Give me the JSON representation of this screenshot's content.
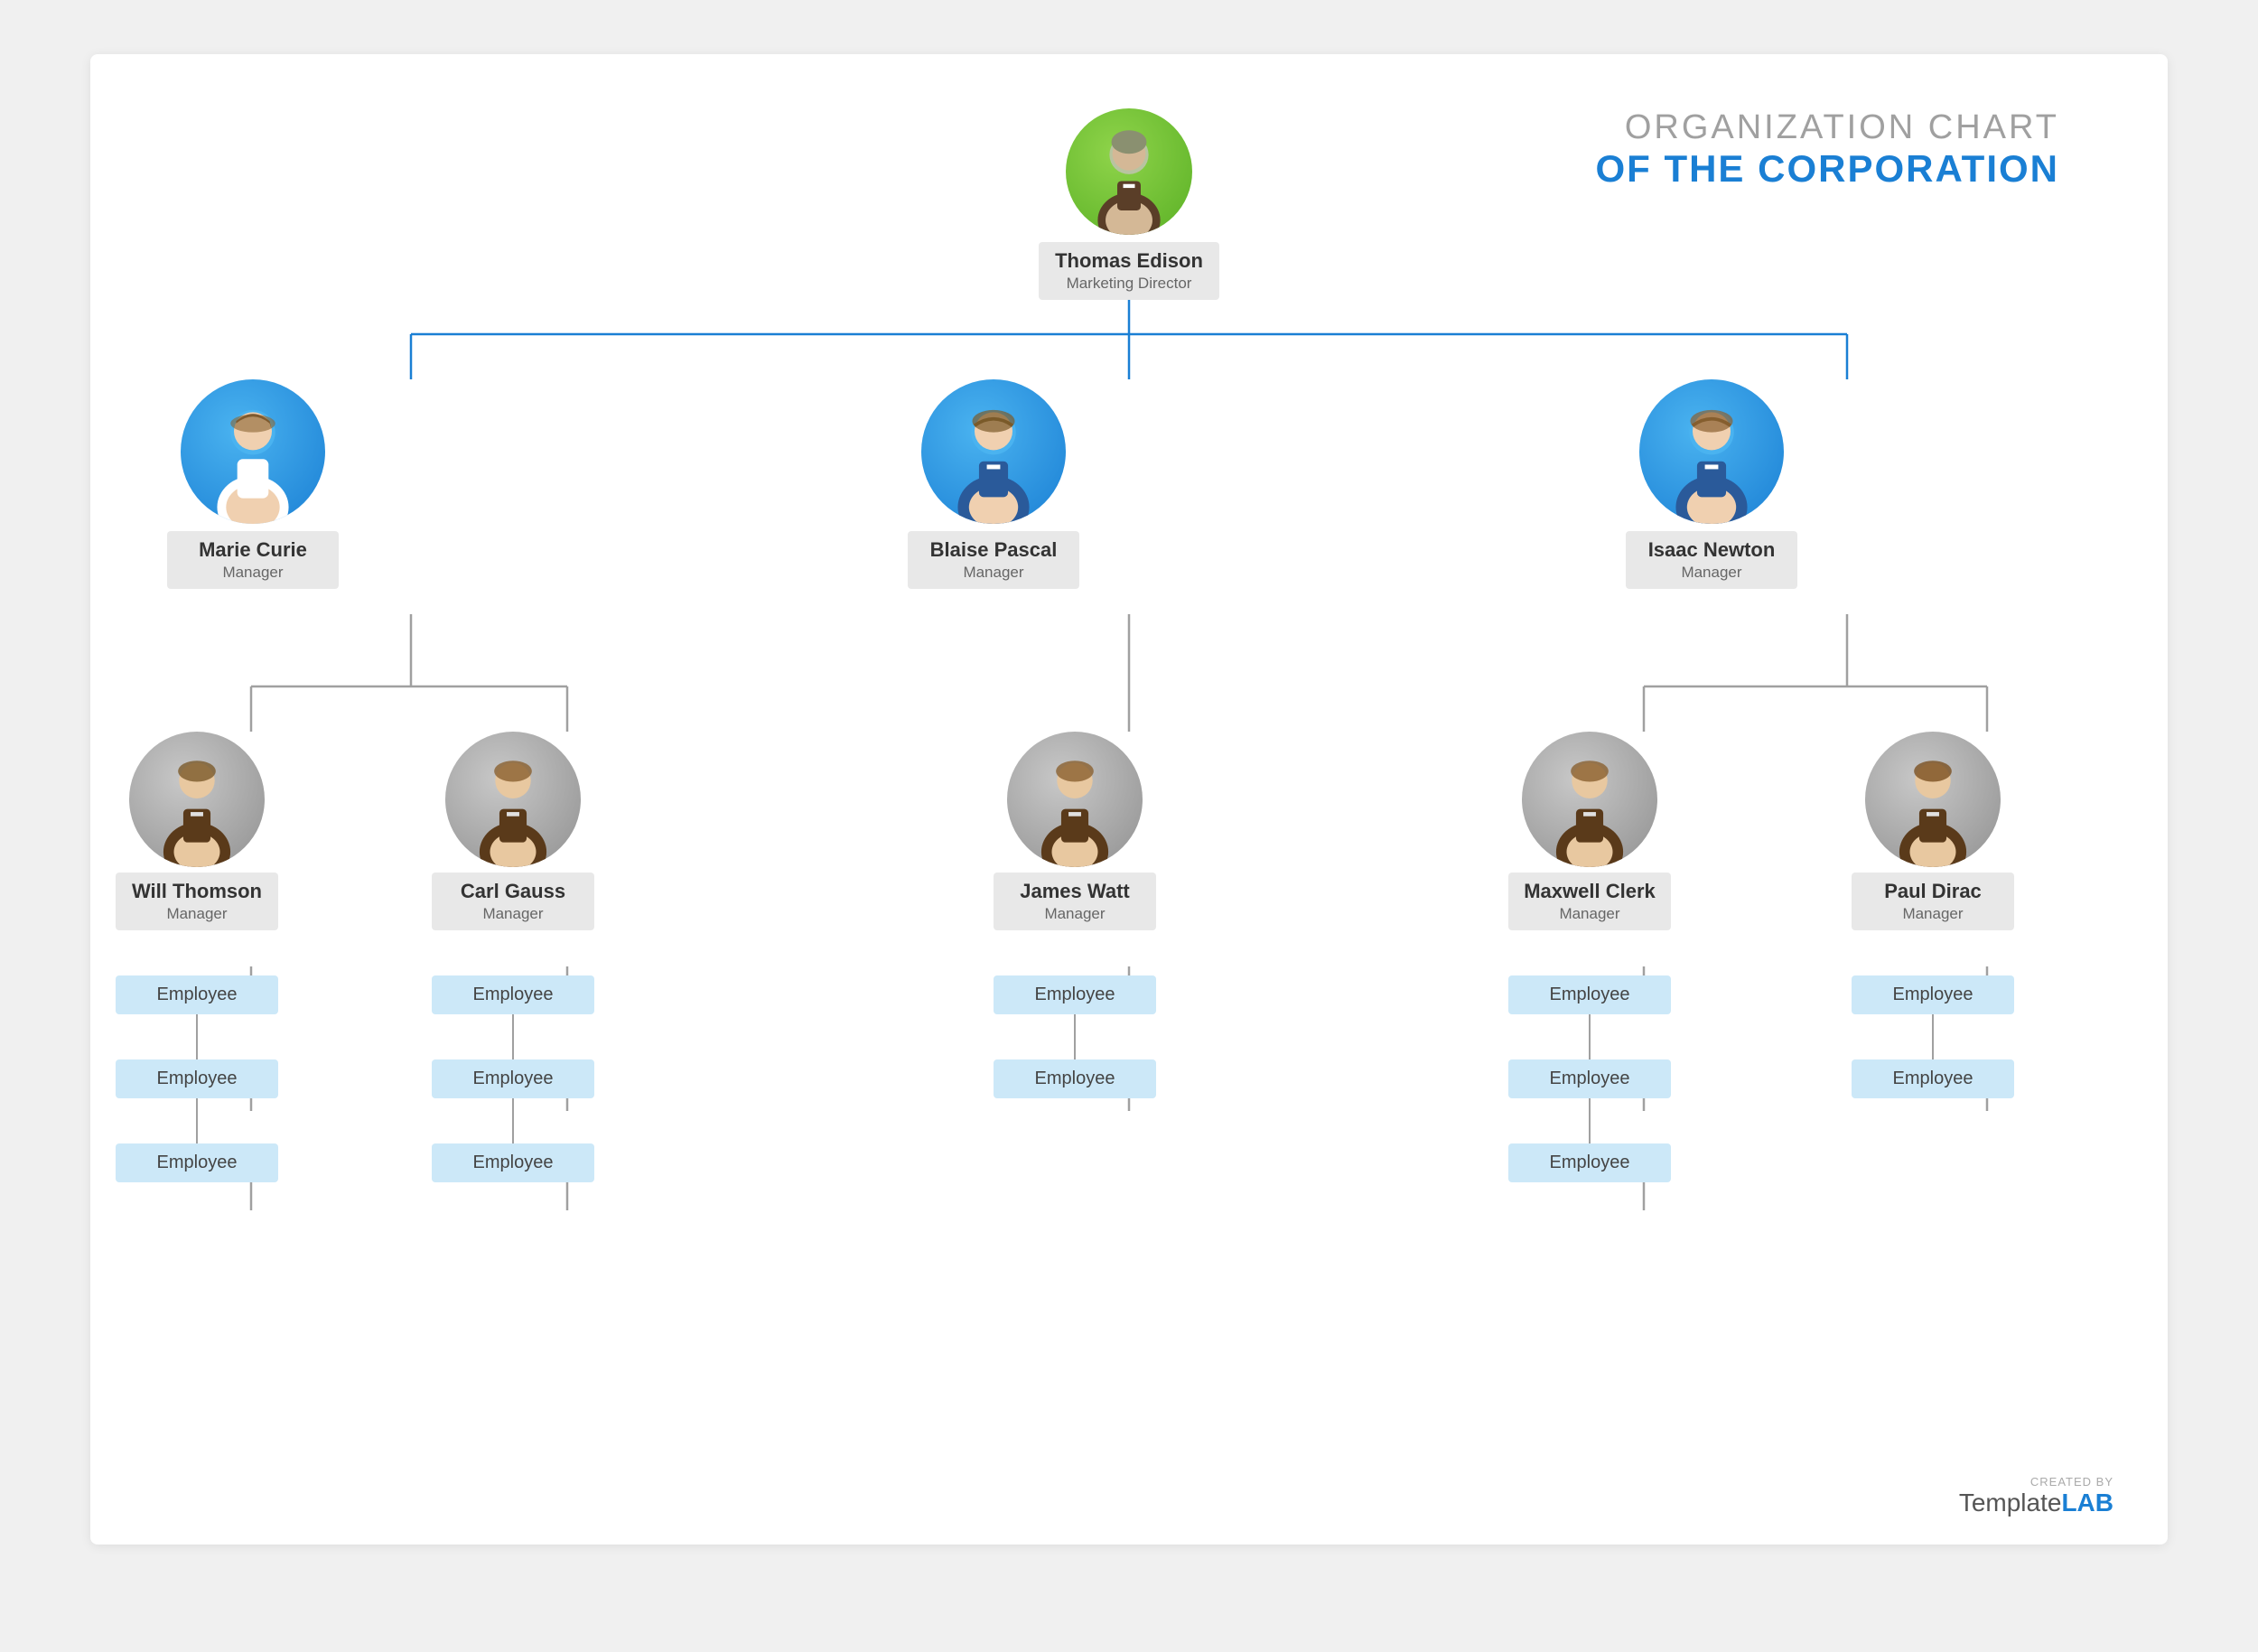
{
  "title": {
    "line1": "ORGANIZATION CHART",
    "line2": "OF THE CORPORATION"
  },
  "watermark": {
    "created_by": "CREATED BY",
    "brand1": "Template",
    "brand2": "LAB"
  },
  "ceo": {
    "name": "Thomas Edison",
    "role": "Marketing Director",
    "avatar_type": "green"
  },
  "managers": [
    {
      "name": "Marie Curie",
      "role": "Manager",
      "avatar_type": "blue",
      "gender": "female"
    },
    {
      "name": "Blaise Pascal",
      "role": "Manager",
      "avatar_type": "blue",
      "gender": "male"
    },
    {
      "name": "Isaac Newton",
      "role": "Manager",
      "avatar_type": "blue",
      "gender": "male"
    }
  ],
  "sub_managers": [
    {
      "name": "Will Thomson",
      "role": "Manager",
      "avatar_type": "gray",
      "parent": 0
    },
    {
      "name": "Carl Gauss",
      "role": "Manager",
      "avatar_type": "gray",
      "parent": 0
    },
    {
      "name": "James Watt",
      "role": "Manager",
      "avatar_type": "gray",
      "parent": 1
    },
    {
      "name": "Maxwell Clerk",
      "role": "Manager",
      "avatar_type": "gray",
      "parent": 2
    },
    {
      "name": "Paul Dirac",
      "role": "Manager",
      "avatar_type": "gray",
      "parent": 2
    }
  ],
  "employees": {
    "will_thomson": [
      "Employee",
      "Employee",
      "Employee"
    ],
    "carl_gauss": [
      "Employee",
      "Employee",
      "Employee"
    ],
    "james_watt": [
      "Employee",
      "Employee"
    ],
    "maxwell_clerk": [
      "Employee",
      "Employee",
      "Employee"
    ],
    "paul_dirac": [
      "Employee",
      "Employee"
    ]
  },
  "colors": {
    "blue_line": "#1a7fd4",
    "gray_line": "#a0a0a0",
    "emp_box": "#cce8f8",
    "name_card_bg": "#e8e8e8",
    "title_gray": "#a0a0a0",
    "title_blue": "#1a7fd4"
  }
}
